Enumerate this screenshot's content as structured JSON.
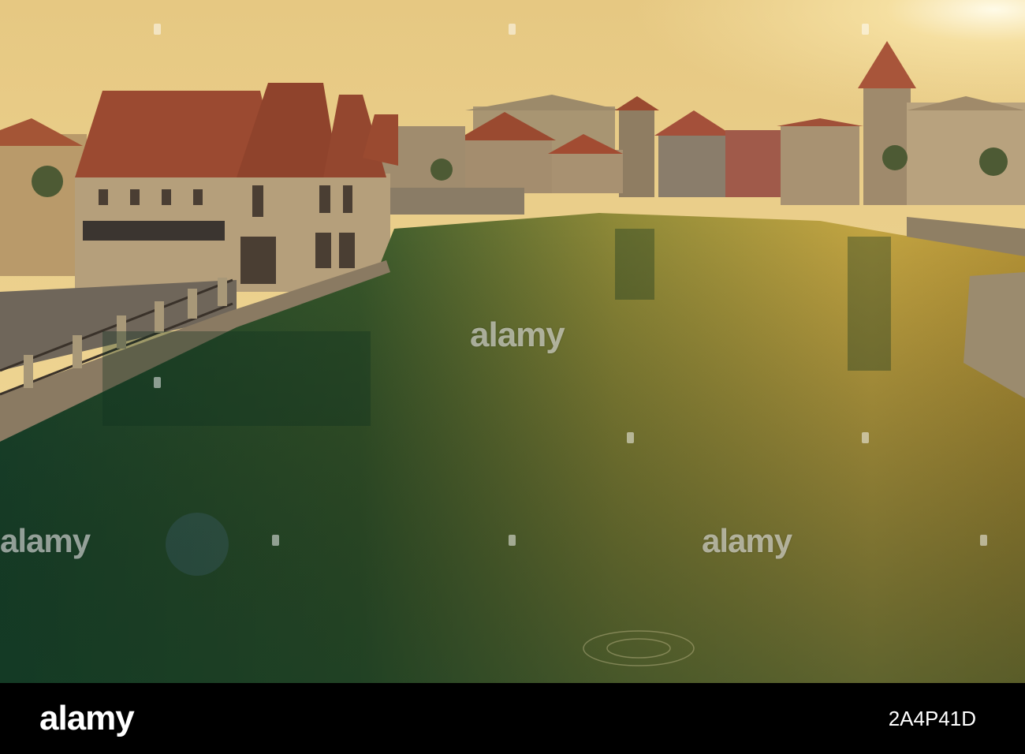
{
  "watermark": {
    "text": "alamy"
  },
  "footer": {
    "brand": "alamy",
    "image_id": "2A4P41D"
  },
  "colors": {
    "sky_top": "#e9cf86",
    "sky_bottom": "#f4dd9a",
    "water_dark": "#1f4a2e",
    "water_glow": "#c8a543",
    "roof": "#9a4a30",
    "stone": "#b8a07a",
    "footer_bg": "#000000",
    "footer_text": "#ffffff"
  }
}
